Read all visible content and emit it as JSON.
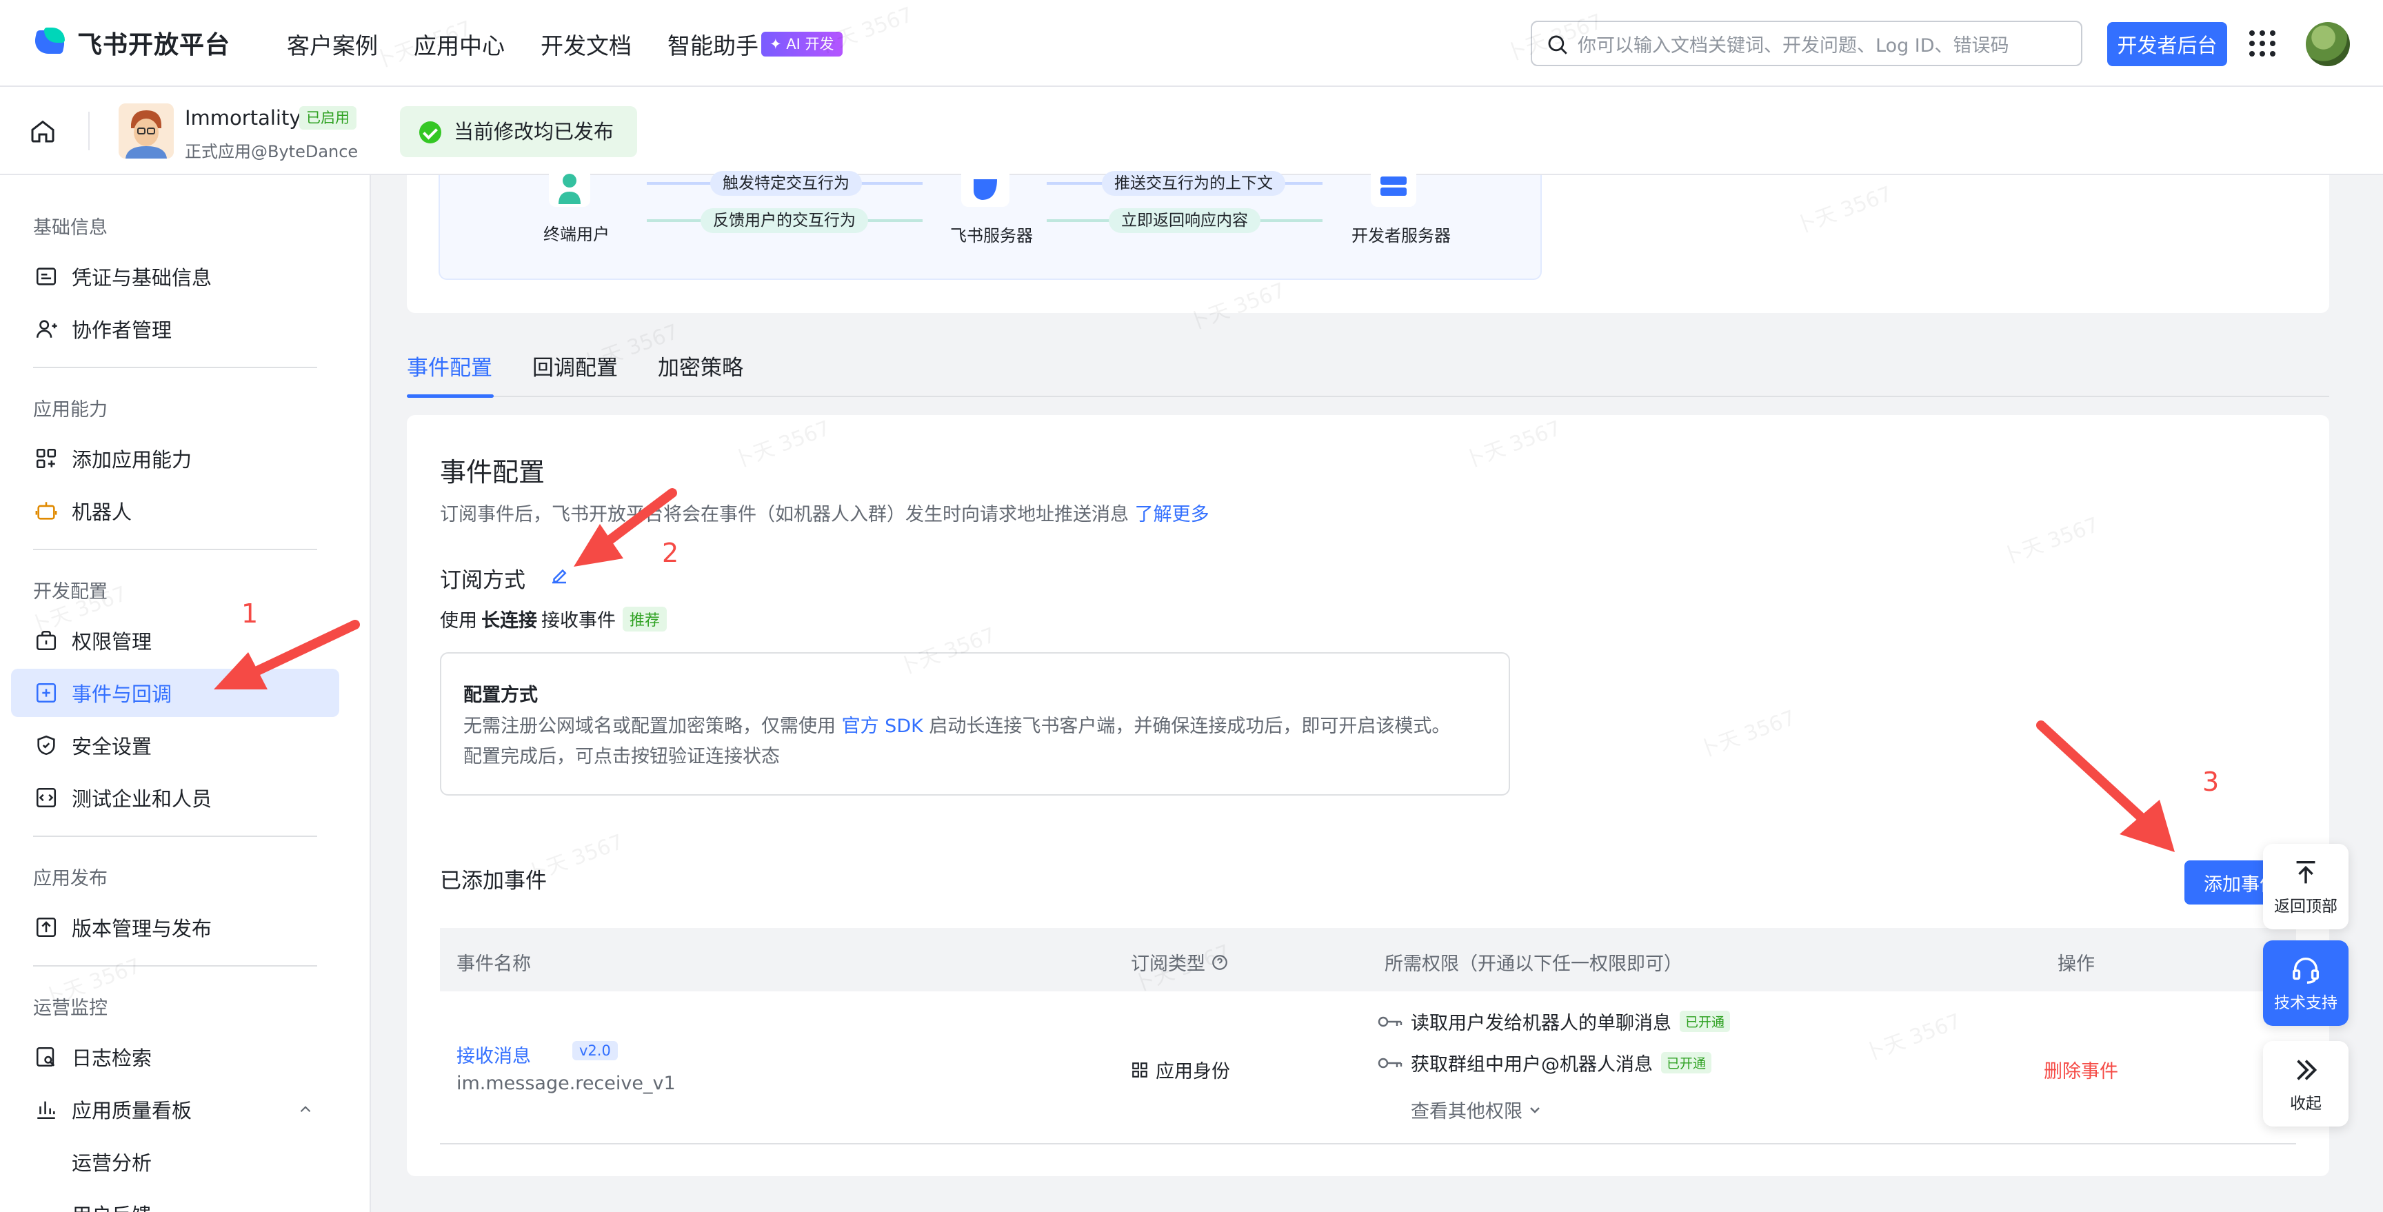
{
  "topnav": {
    "logo_text": "飞书开放平台",
    "nav_items": [
      "客户案例",
      "应用中心",
      "开发文档",
      "智能助手"
    ],
    "ai_badge": "✦ AI 开发",
    "search_placeholder": "你可以输入文档关键词、开发问题、Log ID、错误码",
    "dev_console": "开发者后台"
  },
  "appbar": {
    "app_name": "Immortality",
    "status": "已启用",
    "app_sub": "正式应用@ByteDance",
    "toast": "当前修改均已发布"
  },
  "sidebar": {
    "groups": [
      "基础信息",
      "应用能力",
      "开发配置",
      "应用发布",
      "运营监控"
    ],
    "items": [
      {
        "label": "凭证与基础信息",
        "icon": "credential-icon"
      },
      {
        "label": "协作者管理",
        "icon": "user-add-icon"
      },
      {
        "label": "添加应用能力",
        "icon": "apps-add-icon"
      },
      {
        "label": "机器人",
        "icon": "robot-icon"
      },
      {
        "label": "权限管理",
        "icon": "permission-icon"
      },
      {
        "label": "事件与回调",
        "icon": "event-icon"
      },
      {
        "label": "安全设置",
        "icon": "shield-icon"
      },
      {
        "label": "测试企业和人员",
        "icon": "test-icon"
      },
      {
        "label": "版本管理与发布",
        "icon": "publish-icon"
      },
      {
        "label": "日志检索",
        "icon": "log-search-icon"
      },
      {
        "label": "应用质量看板",
        "icon": "chart-icon"
      },
      {
        "label": "运营分析",
        "icon": ""
      },
      {
        "label": "用户反馈",
        "icon": ""
      }
    ]
  },
  "flow": {
    "end_user": "终端用户",
    "feishu_server": "飞书服务器",
    "dev_server": "开发者服务器",
    "pill_trigger": "触发特定交互行为",
    "pill_feedback": "反馈用户的交互行为",
    "pill_push": "推送交互行为的上下文",
    "pill_return": "立即返回响应内容"
  },
  "tabs": [
    "事件配置",
    "回调配置",
    "加密策略"
  ],
  "event_config": {
    "title": "事件配置",
    "desc": "订阅事件后，飞书开放平台将会在事件（如机器人入群）发生时向请求地址推送消息",
    "learn_more": "了解更多",
    "sub_method_title": "订阅方式",
    "use_prefix": "使用",
    "use_bold": "长连接",
    "use_suffix": "接收事件",
    "recommend": "推荐",
    "conf_title": "配置方式",
    "conf_text_1": "无需注册公网域名或配置加密策略，仅需使用",
    "conf_link": "官方 SDK",
    "conf_text_2": "启动长连接飞书客户端，并确保连接成功后，即可开启该模式。",
    "conf_text_3": "配置完成后，可点击按钮验证连接状态",
    "added_title": "已添加事件",
    "add_button": "添加事件"
  },
  "table": {
    "headers": [
      "事件名称",
      "订阅类型",
      "所需权限（开通以下任一权限即可）",
      "操作"
    ],
    "rows": [
      {
        "name": "接收消息",
        "version": "v2.0",
        "key": "im.message.receive_v1",
        "sub_type": "应用身份",
        "perms": [
          {
            "label": "读取用户发给机器人的单聊消息",
            "status": "已开通"
          },
          {
            "label": "获取群组中用户@机器人消息",
            "status": "已开通"
          }
        ],
        "more_perms": "查看其他权限",
        "action": "删除事件"
      }
    ]
  },
  "float_buttons": [
    "返回顶部",
    "技术支持",
    "收起"
  ],
  "annotations": [
    "1",
    "2",
    "3"
  ],
  "watermark": "卜天 3567",
  "colors": {
    "accent": "#3370ff",
    "danger": "#f54a45",
    "success": "#2ea121",
    "annotation": "#f54a45"
  }
}
